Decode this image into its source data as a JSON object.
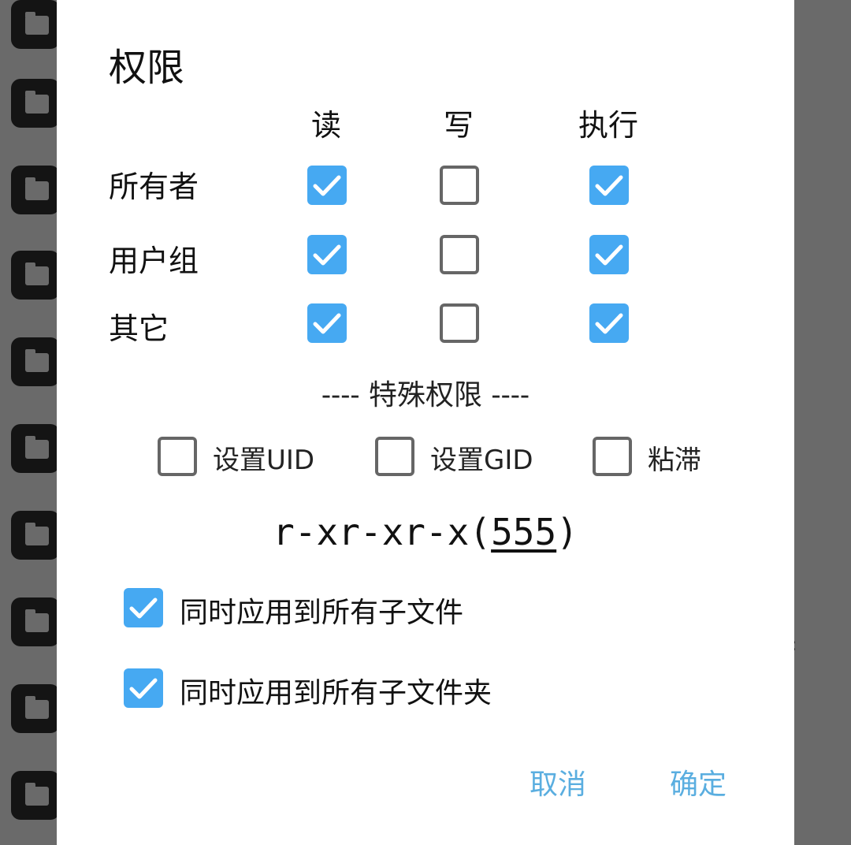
{
  "background": {
    "folder_icon": "folder-icon",
    "colon": ":"
  },
  "dialog": {
    "title": "权限",
    "columns": [
      "读",
      "写",
      "执行"
    ],
    "rows": [
      {
        "label": "所有者",
        "read": true,
        "write": false,
        "execute": true
      },
      {
        "label": "用户组",
        "read": true,
        "write": false,
        "execute": true
      },
      {
        "label": "其它",
        "read": true,
        "write": false,
        "execute": true
      }
    ],
    "special_title": "---- 特殊权限 ----",
    "special": [
      {
        "label": "设置UID",
        "checked": false
      },
      {
        "label": "设置GID",
        "checked": false
      },
      {
        "label": "粘滞",
        "checked": false
      }
    ],
    "perm_symbolic": "r-xr-xr-x",
    "perm_octal": "555",
    "apply_files": {
      "label": "同时应用到所有子文件",
      "checked": true
    },
    "apply_folders": {
      "label": "同时应用到所有子文件夹",
      "checked": true
    },
    "cancel_label": "取消",
    "ok_label": "确定"
  },
  "colors": {
    "checked": "#46a9f2",
    "unchecked_border": "#666666",
    "button_text": "#5aaee0",
    "scrim": "#666666"
  }
}
